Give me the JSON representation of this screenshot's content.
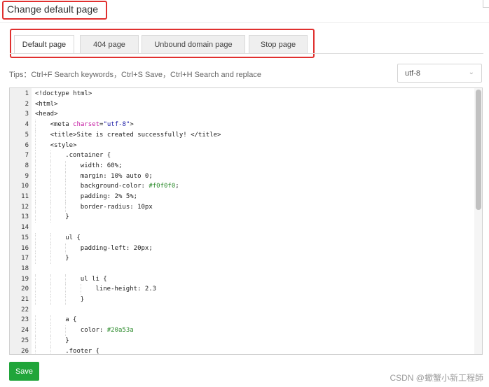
{
  "dialog": {
    "title": "Change default page"
  },
  "tabs": [
    {
      "label": "Default page",
      "active": true
    },
    {
      "label": "404 page",
      "active": false
    },
    {
      "label": "Unbound domain page",
      "active": false
    },
    {
      "label": "Stop page",
      "active": false
    }
  ],
  "tips": "Tips：Ctrl+F Search keywords，Ctrl+S Save，Ctrl+H Search and replace",
  "encoding": {
    "selected": "utf-8"
  },
  "editor": {
    "lines": [
      {
        "num": "1",
        "indent": 0,
        "parts": [
          {
            "t": "<!doctype html>"
          }
        ]
      },
      {
        "num": "2",
        "indent": 0,
        "parts": [
          {
            "t": "<html>"
          }
        ]
      },
      {
        "num": "3",
        "indent": 0,
        "parts": [
          {
            "t": "<head>"
          }
        ]
      },
      {
        "num": "4",
        "indent": 1,
        "parts": [
          {
            "t": "<meta "
          },
          {
            "t": "charset",
            "c": "attr"
          },
          {
            "t": "="
          },
          {
            "t": "\"utf-8\"",
            "c": "str"
          },
          {
            "t": ">"
          }
        ]
      },
      {
        "num": "5",
        "indent": 1,
        "parts": [
          {
            "t": "<title>Site is created successfully! </title>"
          }
        ]
      },
      {
        "num": "6",
        "indent": 1,
        "parts": [
          {
            "t": "<style>"
          }
        ]
      },
      {
        "num": "7",
        "indent": 2,
        "parts": [
          {
            "t": ".container {"
          }
        ]
      },
      {
        "num": "8",
        "indent": 3,
        "parts": [
          {
            "t": "width: 60%;"
          }
        ]
      },
      {
        "num": "9",
        "indent": 3,
        "parts": [
          {
            "t": "margin: 10% auto 0;"
          }
        ]
      },
      {
        "num": "10",
        "indent": 3,
        "parts": [
          {
            "t": "background-color: "
          },
          {
            "t": "#f0f0f0",
            "c": "val"
          },
          {
            "t": ";"
          }
        ]
      },
      {
        "num": "11",
        "indent": 3,
        "parts": [
          {
            "t": "padding: 2% 5%;"
          }
        ]
      },
      {
        "num": "12",
        "indent": 3,
        "parts": [
          {
            "t": "border-radius: 10px"
          }
        ]
      },
      {
        "num": "13",
        "indent": 2,
        "parts": [
          {
            "t": "}"
          }
        ]
      },
      {
        "num": "14",
        "indent": 0,
        "parts": []
      },
      {
        "num": "15",
        "indent": 2,
        "parts": [
          {
            "t": "ul {"
          }
        ]
      },
      {
        "num": "16",
        "indent": 3,
        "parts": [
          {
            "t": "padding-left: 20px;"
          }
        ]
      },
      {
        "num": "17",
        "indent": 2,
        "parts": [
          {
            "t": "}"
          }
        ]
      },
      {
        "num": "18",
        "indent": 0,
        "parts": []
      },
      {
        "num": "19",
        "indent": 3,
        "parts": [
          {
            "t": "ul li {"
          }
        ]
      },
      {
        "num": "20",
        "indent": 4,
        "parts": [
          {
            "t": "line-height: 2.3"
          }
        ]
      },
      {
        "num": "21",
        "indent": 3,
        "parts": [
          {
            "t": "}"
          }
        ]
      },
      {
        "num": "22",
        "indent": 0,
        "parts": []
      },
      {
        "num": "23",
        "indent": 2,
        "parts": [
          {
            "t": "a {"
          }
        ]
      },
      {
        "num": "24",
        "indent": 3,
        "parts": [
          {
            "t": "color: "
          },
          {
            "t": "#20a53a",
            "c": "val"
          }
        ]
      },
      {
        "num": "25",
        "indent": 2,
        "parts": [
          {
            "t": "}"
          }
        ]
      },
      {
        "num": "26",
        "indent": 2,
        "parts": [
          {
            "t": ".footer {"
          }
        ]
      }
    ]
  },
  "actions": {
    "save_label": "Save"
  },
  "watermark": "CSDN @蠍蟹小新工程師",
  "colors": {
    "accent": "#20a53a",
    "highlight_box": "#e0302f"
  }
}
